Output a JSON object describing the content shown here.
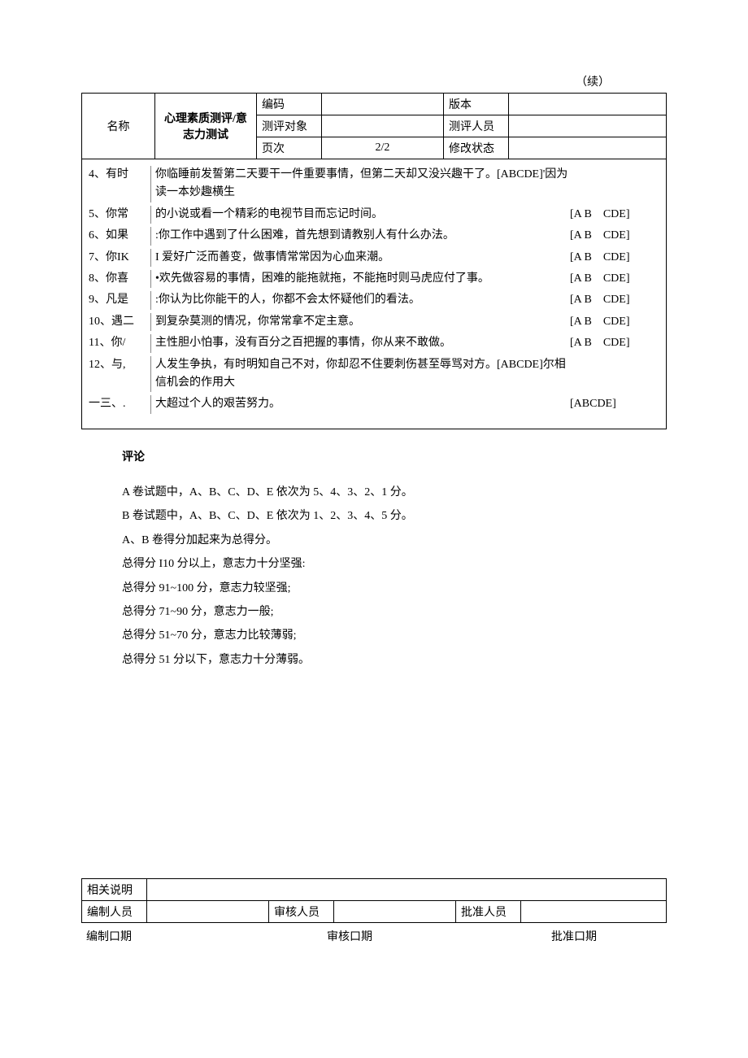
{
  "continued_label": "（续）",
  "header": {
    "name_label": "名称",
    "title": "心理素质测评/意志力测试",
    "rows": [
      {
        "l": "编码",
        "v": "",
        "l2": "版本",
        "v2": ""
      },
      {
        "l": "测评对象",
        "v": "",
        "l2": "测评人员",
        "v2": ""
      },
      {
        "l": "页次",
        "v": "2/2",
        "l2": "修改状态",
        "v2": ""
      }
    ]
  },
  "questions": [
    {
      "num": "4、有时",
      "text": "你临睡前发誓第二天要干一件重要事情，但第二天却又没兴趣干了。[ABCDE]'因为读一本妙趣横生",
      "opts": ""
    },
    {
      "num": "5、你常",
      "text": "的小说或看一个精彩的电视节目而忘记时间。",
      "opts": "[A B　CDE]"
    },
    {
      "num": "6、如果",
      "text": ":你工作中遇到了什么困难，首先想到请教别人有什么办法。",
      "opts": "[A B　CDE]"
    },
    {
      "num": "7、你IK",
      "text": "I 爱好广泛而善变，做事情常常因为心血来潮。",
      "opts": "[A B　CDE]"
    },
    {
      "num": "8、你喜",
      "text": "•欢先做容易的事情，困难的能拖就拖，不能拖时则马虎应付了事。",
      "opts": "[A B　CDE]"
    },
    {
      "num": "9、凡是",
      "text": ":你认为比你能干的人，你都不会太怀疑他们的看法。",
      "opts": "[A B　CDE]"
    },
    {
      "num": "10、遇二",
      "text": "到复杂莫测的情况，你常常拿不定主意。",
      "opts": "[A B　CDE]"
    },
    {
      "num": "11、你/",
      "text": "主性胆小怕事，没有百分之百把握的事情，你从来不敢做。",
      "opts": "[A B　CDE]"
    },
    {
      "num": "12、与,",
      "text": "人发生争执，有时明知自己不对，你却忍不住要刺伤甚至辱骂对方。[ABCDE]尔相信机会的作用大",
      "opts": ""
    },
    {
      "num": "一三、.",
      "text": "大超过个人的艰苦努力。",
      "opts": "[ABCDE]"
    }
  ],
  "comment": {
    "title": "评论",
    "lines": [
      "A 卷试题中，A、B、C、D、E 依次为 5、4、3、2、1 分。",
      "B 卷试题中，A、B、C、D、E 依次为 1、2、3、4、5 分。",
      "A、B 卷得分加起来为总得分。",
      "总得分 I10 分以上，意志力十分坚强:",
      "总得分 91~100 分，意志力较坚强;",
      "总得分 71~90 分，意志力一般;",
      "总得分 51~70 分，意志力比较薄弱;",
      "总得分 51 分以下，意志力十分薄弱。"
    ]
  },
  "footer": {
    "desc_label": "相关说明",
    "compiler_label": "编制人员",
    "reviewer_label": "审核人员",
    "approver_label": "批准人员",
    "compile_date_label": "编制口期",
    "review_date_label": "审核口期",
    "approve_date_label": "批准口期"
  }
}
